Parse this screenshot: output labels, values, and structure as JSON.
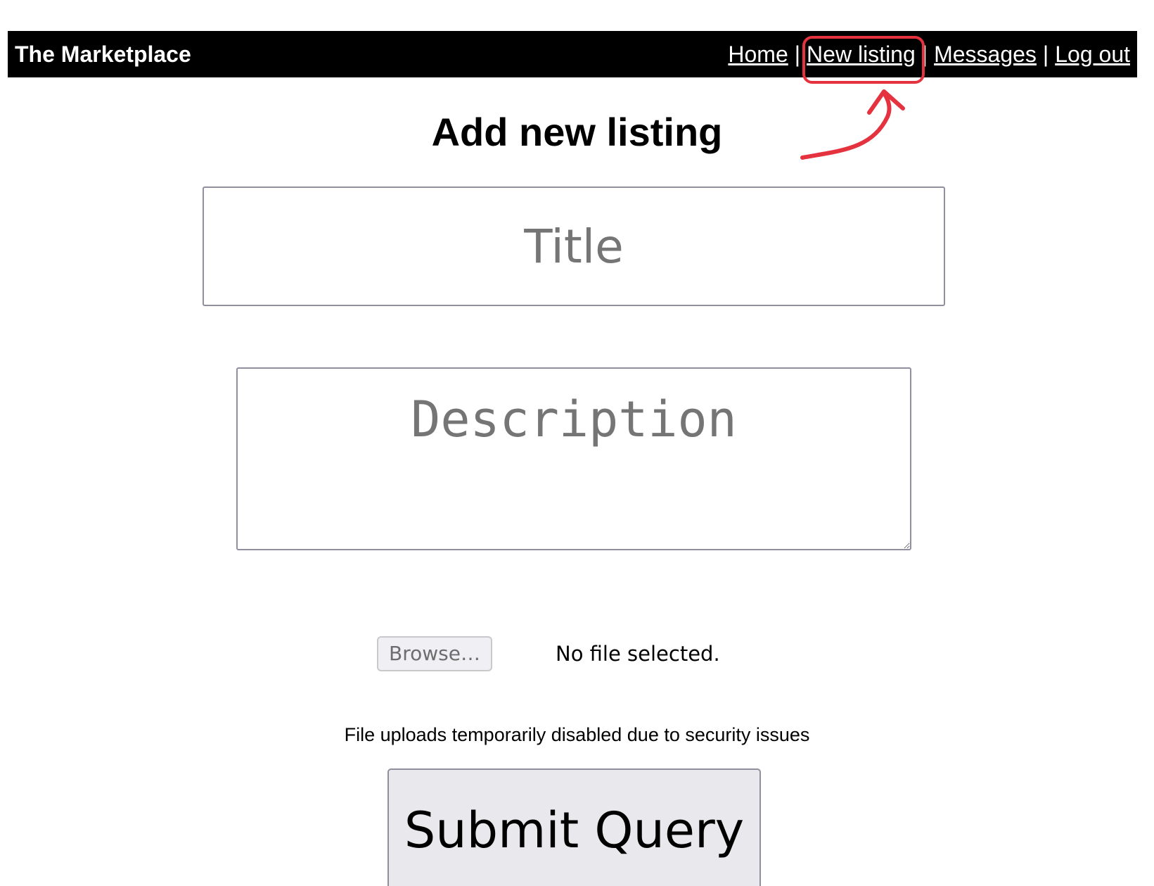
{
  "header": {
    "brand": "The Marketplace",
    "nav": {
      "home": "Home",
      "new_listing": "New listing",
      "messages": "Messages",
      "log_out": "Log out",
      "separator": "|"
    }
  },
  "main": {
    "heading": "Add new listing",
    "title_placeholder": "Title",
    "title_value": "",
    "description_placeholder": "Description",
    "description_value": "",
    "browse_label": "Browse…",
    "file_status": "No file selected.",
    "upload_note": "File uploads temporarily disabled due to security issues",
    "submit_label": "Submit Query"
  },
  "annotation": {
    "color": "#e5323f",
    "target": "New listing"
  },
  "colors": {
    "navbar_bg": "#000000",
    "navbar_text": "#ffffff",
    "submit_bg": "#e9e9ed"
  }
}
